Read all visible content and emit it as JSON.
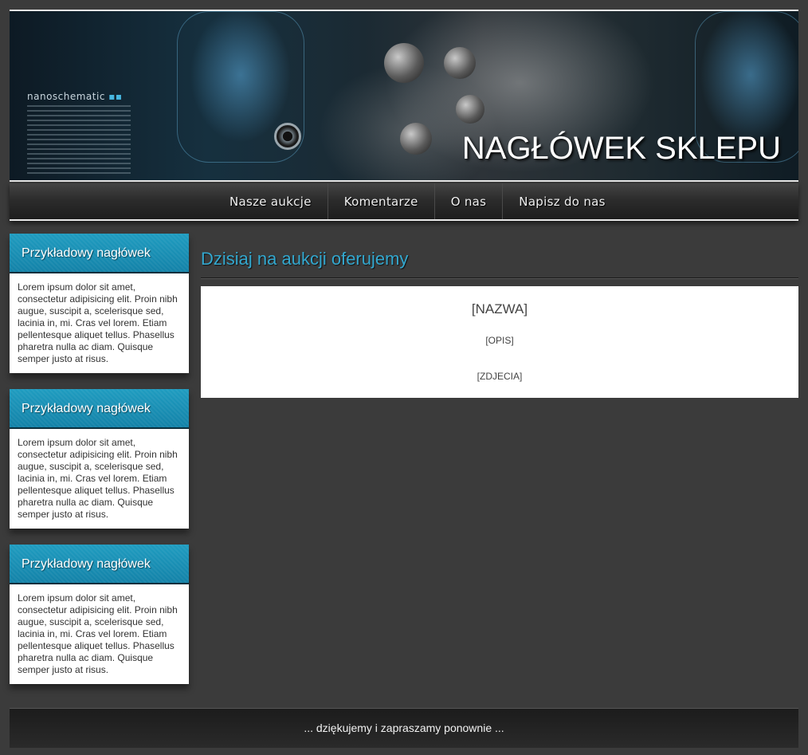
{
  "header": {
    "brand_logo_text": "nanoschematic",
    "title": "NAGŁÓWEK SKLEPU"
  },
  "nav": {
    "items": [
      {
        "label": "Nasze aukcje"
      },
      {
        "label": "Komentarze"
      },
      {
        "label": "O nas"
      },
      {
        "label": "Napisz do nas"
      }
    ]
  },
  "sidebar": {
    "boxes": [
      {
        "heading": "Przykładowy nagłówek",
        "body": "Lorem ipsum dolor sit amet, consectetur adipisicing elit. Proin nibh augue, suscipit a, scelerisque sed, lacinia in, mi. Cras vel lorem. Etiam pellentesque aliquet tellus. Phasellus pharetra nulla ac diam. Quisque semper justo at risus."
      },
      {
        "heading": "Przykładowy nagłówek",
        "body": "Lorem ipsum dolor sit amet, consectetur adipisicing elit. Proin nibh augue, suscipit a, scelerisque sed, lacinia in, mi. Cras vel lorem. Etiam pellentesque aliquet tellus. Phasellus pharetra nulla ac diam. Quisque semper justo at risus."
      },
      {
        "heading": "Przykładowy nagłówek",
        "body": "Lorem ipsum dolor sit amet, consectetur adipisicing elit. Proin nibh augue, suscipit a, scelerisque sed, lacinia in, mi. Cras vel lorem. Etiam pellentesque aliquet tellus. Phasellus pharetra nulla ac diam. Quisque semper justo at risus."
      }
    ]
  },
  "main": {
    "title": "Dzisiaj na aukcji oferujemy",
    "auction": {
      "name": "[NAZWA]",
      "description": "[OPIS]",
      "photos": "[ZDJECIA]"
    }
  },
  "footer": {
    "text": "... dziękujemy i zapraszamy ponownie ..."
  },
  "colors": {
    "page_background": "#3b3b3b",
    "accent": "#33a8cf",
    "sidebar_header": "#1382a8",
    "content_background": "#ffffff"
  }
}
